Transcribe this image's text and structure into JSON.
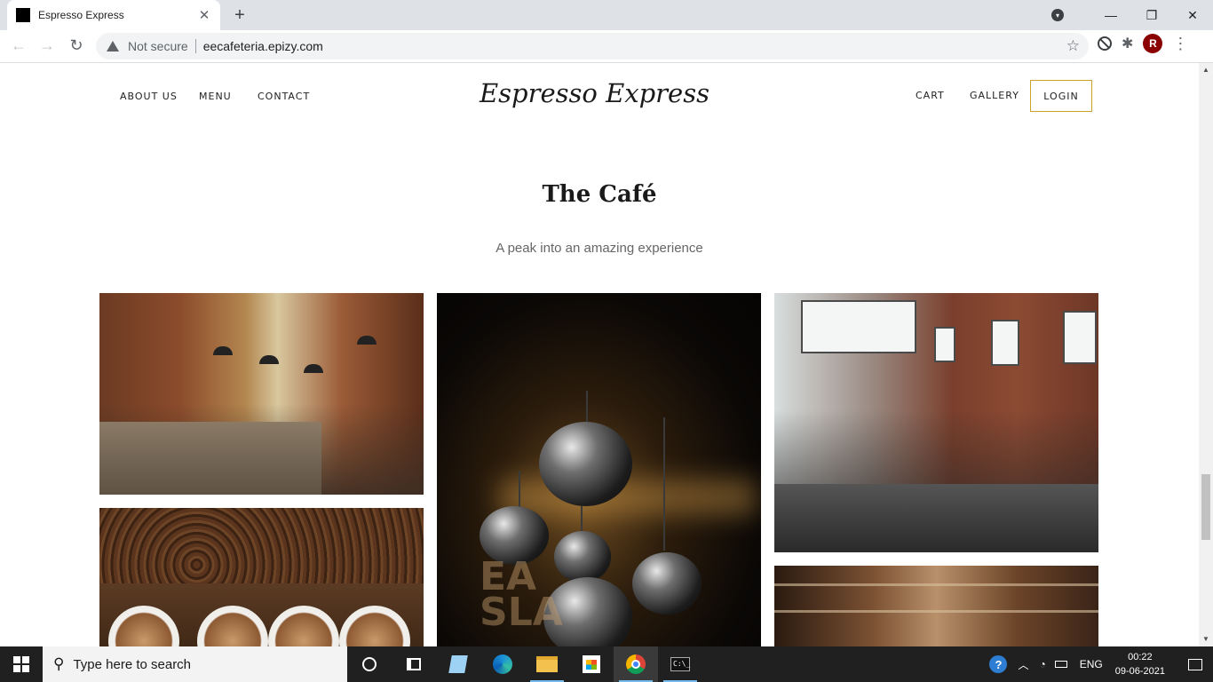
{
  "browser": {
    "tab_title": "Espresso Express",
    "tab_close": "✕",
    "new_tab": "+",
    "security_text": "Not secure",
    "url": "eecafeteria.epizy.com",
    "profile_initial": "R",
    "window_controls": {
      "minimize": "—",
      "maximize": "❐",
      "close": "✕"
    }
  },
  "site": {
    "nav_left": [
      "ABOUT US",
      "MENU",
      "CONTACT"
    ],
    "brand": "Espresso Express",
    "nav_right": [
      "CART",
      "GALLERY"
    ],
    "login": "LOGIN",
    "accent_color": "#c9a227"
  },
  "section": {
    "title": "The Café",
    "subtitle": "A peak into an amazing experience"
  },
  "gallery": [
    {
      "name": "cafe-interior-counter"
    },
    {
      "name": "pendant-lamps"
    },
    {
      "name": "cafe-dining-room"
    },
    {
      "name": "coffee-beans-cups"
    },
    {
      "name": "coffee-bar"
    }
  ],
  "taskbar": {
    "search_placeholder": "Type here to search",
    "language": "ENG",
    "time": "00:22",
    "date": "09-06-2021",
    "icons": [
      "cortana-icon",
      "task-view-icon",
      "edge-icon",
      "file-explorer-icon",
      "store-icon",
      "chrome-icon",
      "terminal-icon"
    ]
  }
}
